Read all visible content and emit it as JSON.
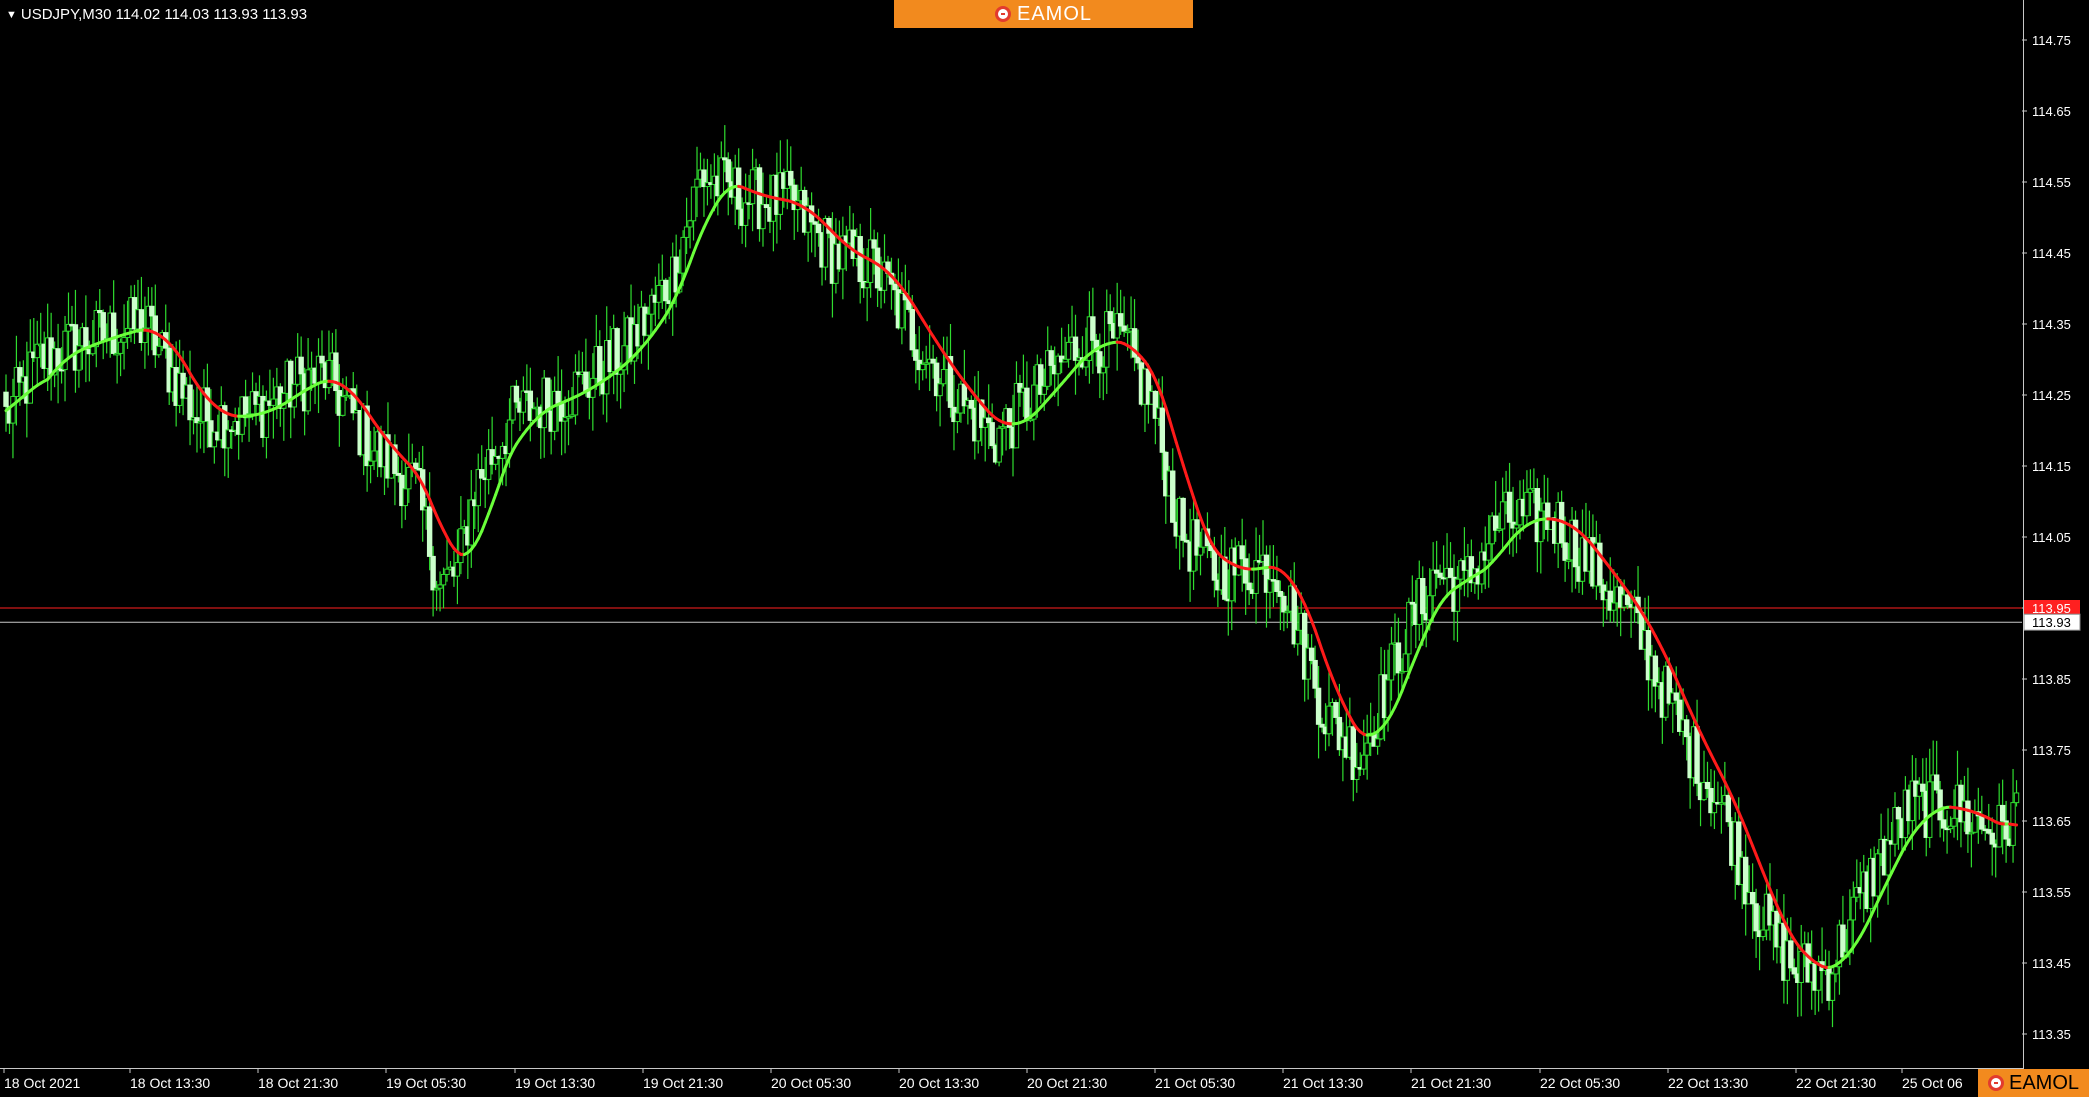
{
  "header": {
    "menu_icon": "triangle-down-icon",
    "symbol": "USDJPY,M30",
    "ohlc": "114.02 114.03 113.93 113.93"
  },
  "brand": {
    "name": "EAMOL",
    "logo_icon": "eamol-logo-icon",
    "color": "#f28a1e"
  },
  "chart_data": {
    "type": "candlestick",
    "symbol": "USDJPY",
    "timeframe": "M30",
    "ylim": [
      113.3,
      114.8
    ],
    "y_ticks": [
      "114.75",
      "114.65",
      "114.55",
      "114.45",
      "114.35",
      "114.25",
      "114.15",
      "114.05",
      "113.95",
      "113.85",
      "113.75",
      "113.65",
      "113.55",
      "113.45",
      "113.35"
    ],
    "x_ticks": [
      "18 Oct 2021",
      "18 Oct 13:30",
      "18 Oct 21:30",
      "19 Oct 05:30",
      "19 Oct 13:30",
      "19 Oct 21:30",
      "20 Oct 05:30",
      "20 Oct 13:30",
      "20 Oct 21:30",
      "21 Oct 05:30",
      "21 Oct 13:30",
      "21 Oct 21:30",
      "22 Oct 05:30",
      "22 Oct 13:30",
      "22 Oct 21:30",
      "25 Oct 06"
    ],
    "bid_line": {
      "label": "113.95",
      "value": 113.95,
      "color": "#ff2020"
    },
    "current_price": {
      "label": "113.93",
      "value": 113.93,
      "color": "#c8c8c8"
    },
    "candle_colors": {
      "bull": "#2fdc2f",
      "bear": "#ccffcc",
      "wick": "#2fdc2f"
    },
    "indicator": {
      "type": "moving-average",
      "rising_color": "#6aff3a",
      "falling_color": "#ff1a1a"
    },
    "anchors": [
      [
        0,
        114.22
      ],
      [
        10,
        114.3
      ],
      [
        25,
        114.33
      ],
      [
        40,
        114.35
      ],
      [
        55,
        114.22
      ],
      [
        70,
        114.22
      ],
      [
        85,
        114.27
      ],
      [
        92,
        114.28
      ],
      [
        105,
        114.18
      ],
      [
        118,
        114.12
      ],
      [
        125,
        113.98
      ],
      [
        130,
        114.0
      ],
      [
        135,
        114.12
      ],
      [
        146,
        114.22
      ],
      [
        165,
        114.26
      ],
      [
        180,
        114.32
      ],
      [
        192,
        114.42
      ],
      [
        200,
        114.56
      ],
      [
        212,
        114.53
      ],
      [
        226,
        114.52
      ],
      [
        238,
        114.45
      ],
      [
        250,
        114.43
      ],
      [
        262,
        114.33
      ],
      [
        275,
        114.24
      ],
      [
        285,
        114.19
      ],
      [
        300,
        114.27
      ],
      [
        310,
        114.33
      ],
      [
        322,
        114.32
      ],
      [
        330,
        114.24
      ],
      [
        338,
        114.06
      ],
      [
        348,
        114.0
      ],
      [
        362,
        114.01
      ],
      [
        366,
        114.01
      ],
      [
        372,
        113.92
      ],
      [
        380,
        113.8
      ],
      [
        390,
        113.74
      ],
      [
        402,
        113.9
      ],
      [
        412,
        114.0
      ],
      [
        420,
        113.98
      ],
      [
        430,
        114.07
      ],
      [
        445,
        114.08
      ],
      [
        455,
        114.02
      ],
      [
        470,
        113.92
      ],
      [
        482,
        113.78
      ],
      [
        495,
        113.66
      ],
      [
        505,
        113.52
      ],
      [
        515,
        113.44
      ],
      [
        525,
        113.44
      ],
      [
        538,
        113.58
      ],
      [
        548,
        113.67
      ],
      [
        560,
        113.67
      ],
      [
        575,
        113.63
      ],
      [
        578,
        113.66
      ]
    ]
  }
}
